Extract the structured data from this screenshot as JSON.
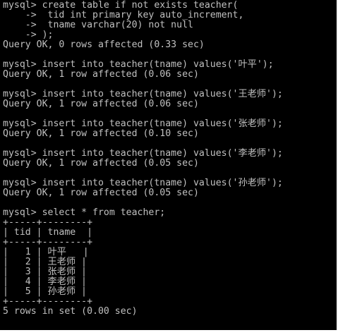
{
  "colors": {
    "background": "#000000",
    "foreground": "#c0c0c0"
  },
  "lines": [
    "mysql> create table if not exists teacher(",
    "    ->  tid int primary key auto_increment,",
    "    ->  tname varchar(20) not null",
    "    -> );",
    "Query OK, 0 rows affected (0.33 sec)",
    "",
    "mysql> insert into teacher(tname) values('叶平');",
    "Query OK, 1 row affected (0.06 sec)",
    "",
    "mysql> insert into teacher(tname) values('王老师');",
    "Query OK, 1 row affected (0.06 sec)",
    "",
    "mysql> insert into teacher(tname) values('张老师');",
    "Query OK, 1 row affected (0.10 sec)",
    "",
    "mysql> insert into teacher(tname) values('李老师');",
    "Query OK, 1 row affected (0.05 sec)",
    "",
    "mysql> insert into teacher(tname) values('孙老师');",
    "Query OK, 1 row affected (0.05 sec)",
    "",
    "mysql> select * from teacher;",
    "+-----+--------+",
    "| tid | tname  |",
    "+-----+--------+",
    "|   1 | 叶平   |",
    "|   2 | 王老师 |",
    "|   3 | 张老师 |",
    "|   4 | 李老师 |",
    "|   5 | 孙老师 |",
    "+-----+--------+",
    "5 rows in set (0.00 sec)"
  ]
}
